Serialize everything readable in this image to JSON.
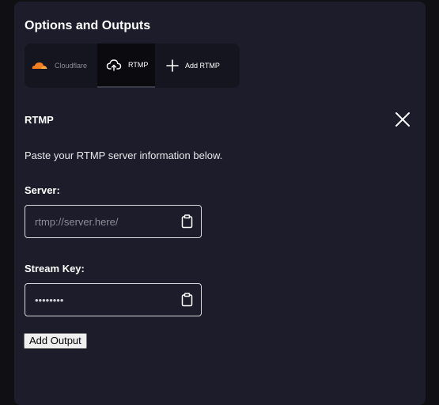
{
  "panel": {
    "title": "Options and Outputs"
  },
  "tabs": [
    {
      "label": "Cloudflare",
      "icon": "cloudflare-logo-icon",
      "active": false
    },
    {
      "label": "RTMP",
      "icon": "cloud-upload-icon",
      "active": true
    },
    {
      "label": "Add RTMP",
      "icon": "plus-icon",
      "active": false
    }
  ],
  "rtmp_form": {
    "title": "RTMP",
    "close_icon": "close-icon",
    "description": "Paste your RTMP server information below.",
    "server": {
      "label": "Server:",
      "placeholder": "rtmp://server.here/",
      "value": ""
    },
    "stream_key": {
      "label": "Stream Key:",
      "value": "••••••••"
    },
    "paste_icon": "clipboard-icon",
    "submit_label": "Add Output"
  },
  "colors": {
    "page_background": "#0f0f14",
    "panel_background": "#1d1c2b",
    "tabbar_background": "#15151f",
    "active_tab_background": "#0b0b0f",
    "cloudflare_orange": "#f38020"
  }
}
